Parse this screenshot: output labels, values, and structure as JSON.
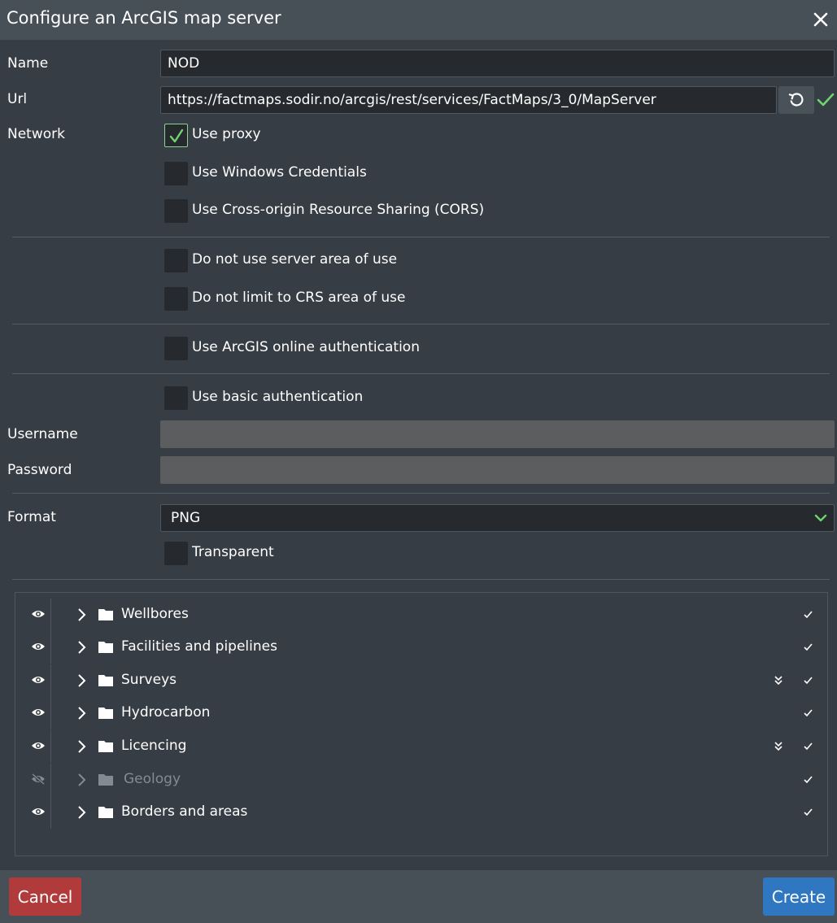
{
  "dialog": {
    "title": "Configure an ArcGIS map server"
  },
  "form": {
    "name_label": "Name",
    "name_value": "NOD",
    "url_label": "Url",
    "url_value": "https://factmaps.sodir.no/arcgis/rest/services/FactMaps/3_0/MapServer",
    "network_label": "Network",
    "checkboxes": {
      "use_proxy": {
        "label": "Use proxy",
        "checked": true
      },
      "use_windows_credentials": {
        "label": "Use Windows Credentials",
        "checked": false
      },
      "use_cors": {
        "label": "Use Cross-origin Resource Sharing (CORS)",
        "checked": false
      },
      "no_server_area": {
        "label": "Do not use server area of use",
        "checked": false
      },
      "no_crs_area": {
        "label": "Do not limit to CRS area of use",
        "checked": false
      },
      "arcgis_online_auth": {
        "label": "Use ArcGIS online authentication",
        "checked": false
      },
      "basic_auth": {
        "label": "Use basic authentication",
        "checked": false
      },
      "transparent": {
        "label": "Transparent",
        "checked": false
      }
    },
    "username_label": "Username",
    "username_value": "",
    "password_label": "Password",
    "password_value": "",
    "format_label": "Format",
    "format_value": "PNG"
  },
  "layers": [
    {
      "name": "Wellbores",
      "visible": true,
      "expand_all": false,
      "checked": true
    },
    {
      "name": "Facilities and pipelines",
      "visible": true,
      "expand_all": false,
      "checked": true
    },
    {
      "name": "Surveys",
      "visible": true,
      "expand_all": true,
      "checked": true
    },
    {
      "name": "Hydrocarbon",
      "visible": true,
      "expand_all": false,
      "checked": true
    },
    {
      "name": "Licencing",
      "visible": true,
      "expand_all": true,
      "checked": true
    },
    {
      "name": "Geology",
      "visible": false,
      "expand_all": false,
      "checked": true
    },
    {
      "name": "Borders and areas",
      "visible": true,
      "expand_all": false,
      "checked": true
    }
  ],
  "footer": {
    "cancel_label": "Cancel",
    "create_label": "Create"
  },
  "colors": {
    "background": "#373d44",
    "header": "#474f57",
    "input": "#262a2e",
    "accent_check": "#6fd46f",
    "cancel": "#b13b3b",
    "create": "#2f77c0"
  },
  "icons": [
    "close-icon",
    "refresh-icon",
    "valid-check-icon",
    "checkmark-icon",
    "chevron-down-icon",
    "eye-icon",
    "eye-off-icon",
    "chevron-right-icon",
    "folder-icon",
    "double-chevron-down-icon",
    "small-check-icon"
  ]
}
